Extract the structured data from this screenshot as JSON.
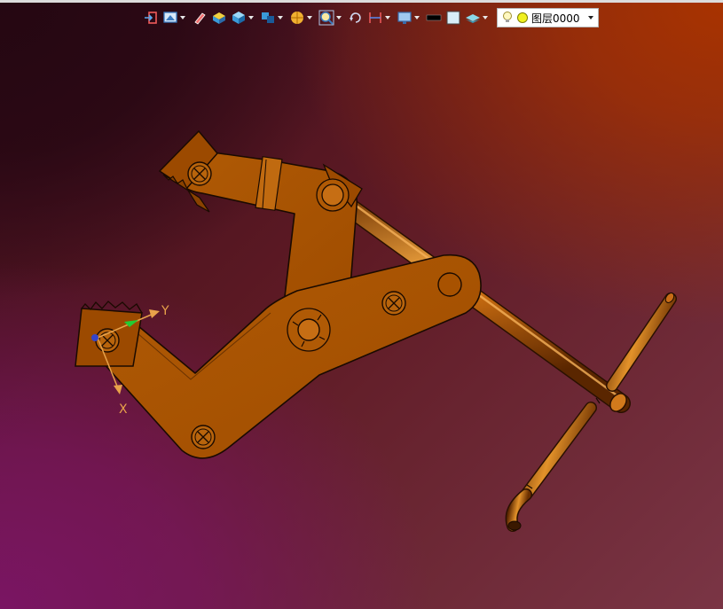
{
  "toolbar": {
    "buttons": [
      {
        "name": "exit-icon",
        "has_dropdown": false
      },
      {
        "name": "view-orientation-icon",
        "has_dropdown": true
      },
      {
        "name": "edit-pen-icon",
        "has_dropdown": false
      },
      {
        "name": "shaded-block-icon",
        "has_dropdown": false
      },
      {
        "name": "cube-icon",
        "has_dropdown": true
      },
      {
        "name": "section-view-icon",
        "has_dropdown": true
      },
      {
        "name": "render-style-icon",
        "has_dropdown": true
      },
      {
        "name": "zoom-fit-icon",
        "has_dropdown": true
      },
      {
        "name": "rotate-icon",
        "has_dropdown": false
      },
      {
        "name": "measure-icon",
        "has_dropdown": true
      },
      {
        "name": "display-settings-icon",
        "has_dropdown": true
      },
      {
        "name": "black-rectangle-icon",
        "has_dropdown": false
      },
      {
        "name": "white-rectangle-icon",
        "has_dropdown": false
      },
      {
        "name": "layer-stack-icon",
        "has_dropdown": true
      }
    ],
    "layer_selector": {
      "value": "图层0000",
      "bulb_icon": "lightbulb-icon",
      "dot_icon": "yellow-dot-icon"
    }
  },
  "axes": {
    "x_label": "X",
    "y_label": "Y"
  },
  "colors": {
    "part_orange": "#a85200",
    "part_edge": "#1a0a00",
    "rod_highlight": "#f0a040",
    "background_top_right": "#a83300",
    "background_bottom_left": "#7a1563"
  }
}
